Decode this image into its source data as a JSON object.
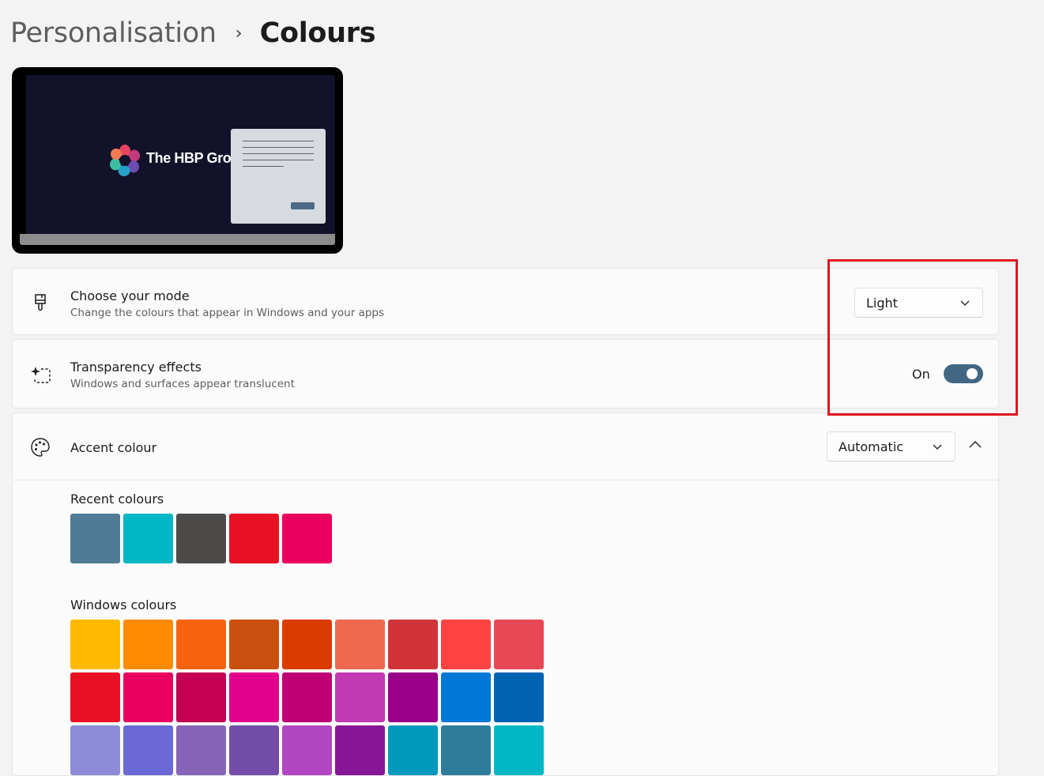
{
  "breadcrumb": {
    "parent": "Personalisation",
    "separator": "›",
    "current": "Colours"
  },
  "preview": {
    "brand_text": "The HBP Gro"
  },
  "mode": {
    "icon": "paintbrush-icon",
    "title": "Choose your mode",
    "description": "Change the colours that appear in Windows and your apps",
    "selected": "Light"
  },
  "transparency": {
    "icon": "transparency-icon",
    "title": "Transparency effects",
    "description": "Windows and surfaces appear translucent",
    "state_label": "On",
    "enabled": true
  },
  "accent": {
    "icon": "palette-icon",
    "title": "Accent colour",
    "selected": "Automatic",
    "expanded": true,
    "recent_label": "Recent colours",
    "recent_colours": [
      "#4f7b94",
      "#00b7c3",
      "#4c4a48",
      "#e81123",
      "#ea005e"
    ],
    "windows_label": "Windows colours",
    "windows_colours": [
      "#ffb900",
      "#ff8c00",
      "#f7630c",
      "#ca5010",
      "#da3b01",
      "#ef6950",
      "#d13438",
      "#ff4343",
      "#e74856",
      "#e81123",
      "#ea005e",
      "#c30052",
      "#e3008c",
      "#bf0077",
      "#c239b3",
      "#9a0089",
      "#0078d7",
      "#0063b1",
      "#8e8cd8",
      "#6b69d6",
      "#8764b8",
      "#744da9",
      "#b146c2",
      "#881798",
      "#0099bc",
      "#2d7d9a",
      "#00b7c3"
    ]
  },
  "colors": {
    "toggle_on": "#416783",
    "highlight_box": "#e0141e"
  }
}
